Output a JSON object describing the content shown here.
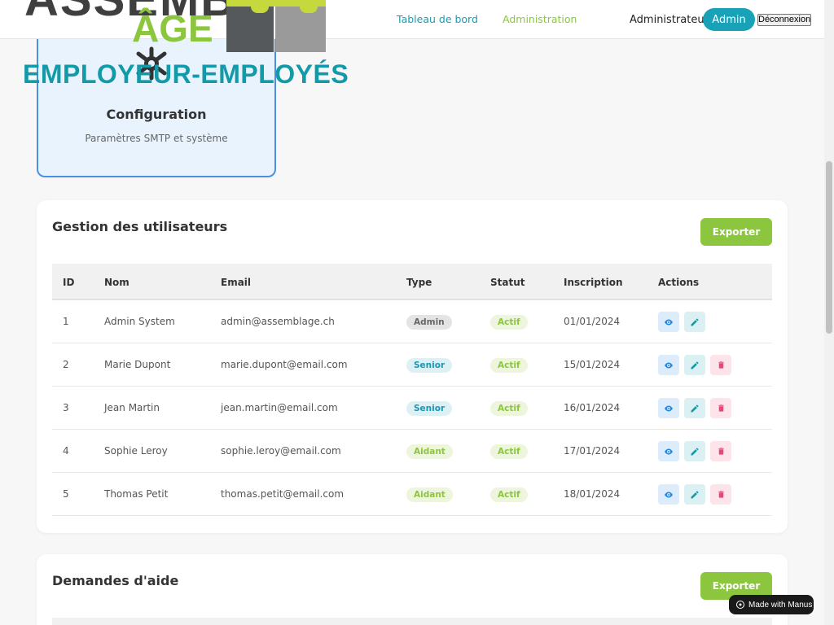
{
  "logo": {
    "brand_top": "ASSEMBL",
    "brand_age": "ÂGE",
    "brand_sub": "EMPLOYEUR-EMPLOYÉS"
  },
  "nav": {
    "dashboard": "Tableau de bord",
    "administration": "Administration",
    "role": "Administrateur",
    "admin_pill": "Admin",
    "logout": "Déconnexion"
  },
  "config_card": {
    "title": "Configuration",
    "description": "Paramètres SMTP et système"
  },
  "users_panel": {
    "title": "Gestion des utilisateurs",
    "export_label": "Exporter",
    "columns": [
      "ID",
      "Nom",
      "Email",
      "Type",
      "Statut",
      "Inscription",
      "Actions"
    ],
    "rows": [
      {
        "id": "1",
        "nom": "Admin System",
        "email": "admin@assemblage.ch",
        "type": "Admin",
        "statut": "Actif",
        "inscription": "01/01/2024"
      },
      {
        "id": "2",
        "nom": "Marie Dupont",
        "email": "marie.dupont@email.com",
        "type": "Senior",
        "statut": "Actif",
        "inscription": "15/01/2024"
      },
      {
        "id": "3",
        "nom": "Jean Martin",
        "email": "jean.martin@email.com",
        "type": "Senior",
        "statut": "Actif",
        "inscription": "16/01/2024"
      },
      {
        "id": "4",
        "nom": "Sophie Leroy",
        "email": "sophie.leroy@email.com",
        "type": "Aidant",
        "statut": "Actif",
        "inscription": "17/01/2024"
      },
      {
        "id": "5",
        "nom": "Thomas Petit",
        "email": "thomas.petit@email.com",
        "type": "Aidant",
        "statut": "Actif",
        "inscription": "18/01/2024"
      }
    ]
  },
  "help_panel": {
    "title": "Demandes d'aide",
    "export_label": "Exporter"
  },
  "manus_badge": "Made with Manus",
  "colors": {
    "teal": "#17a2b8",
    "green": "#8cc63f",
    "config_bg": "#e8f3fd",
    "config_border": "#4a90e2"
  }
}
